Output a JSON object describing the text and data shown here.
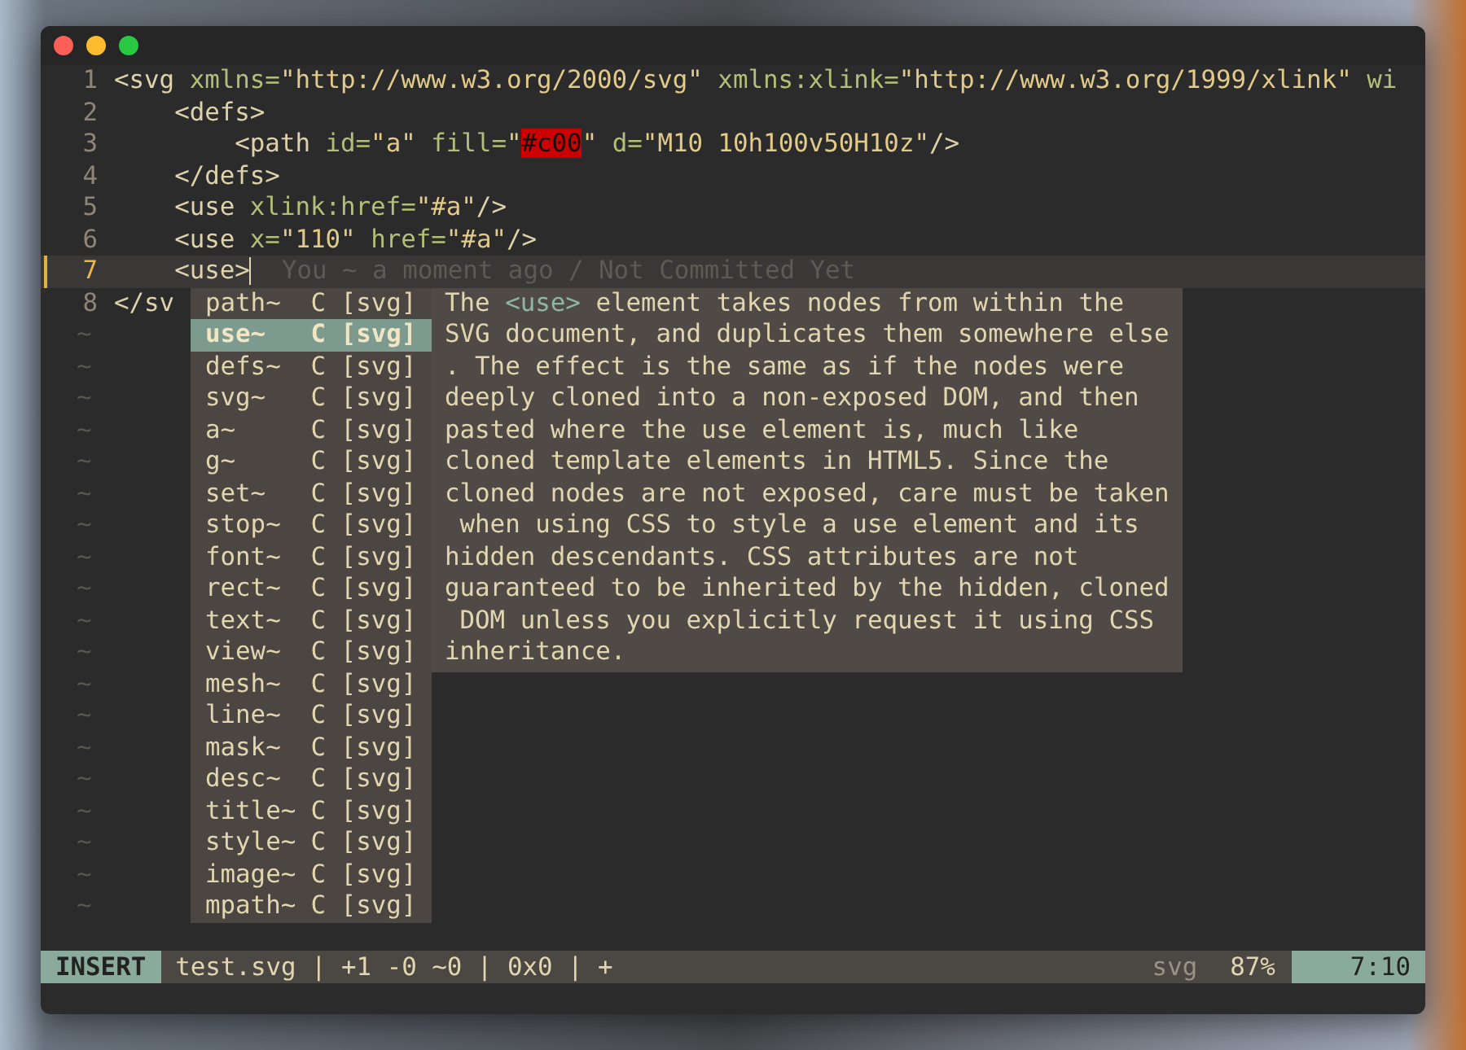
{
  "window": {
    "buttons": [
      {
        "kind": "close"
      },
      {
        "kind": "minimize"
      },
      {
        "kind": "zoom"
      }
    ]
  },
  "editor": {
    "lines": [
      {
        "number": "1",
        "current": false,
        "sign": false,
        "segments": [
          {
            "kind": "tag",
            "text": "<svg"
          },
          {
            "kind": "attr",
            "text": " xmlns="
          },
          {
            "kind": "string",
            "text": "\"http://www.w3.org/2000/svg\""
          },
          {
            "kind": "attr",
            "text": " xmlns:xlink="
          },
          {
            "kind": "string",
            "text": "\"http://www.w3.org/1999/xlink\""
          },
          {
            "kind": "attr",
            "text": " wi"
          }
        ]
      },
      {
        "number": "2",
        "current": false,
        "sign": false,
        "segments": [
          {
            "kind": "tag",
            "text": "    <defs>"
          }
        ]
      },
      {
        "number": "3",
        "current": false,
        "sign": false,
        "segments": [
          {
            "kind": "tag",
            "text": "        <path"
          },
          {
            "kind": "attr",
            "text": " id="
          },
          {
            "kind": "string",
            "text": "\"a\""
          },
          {
            "kind": "attr",
            "text": " fill="
          },
          {
            "kind": "string",
            "text": "\""
          },
          {
            "kind": "color",
            "text": "#c00"
          },
          {
            "kind": "string",
            "text": "\""
          },
          {
            "kind": "attr",
            "text": " d="
          },
          {
            "kind": "string",
            "text": "\"M10 10h100v50H10z\""
          },
          {
            "kind": "tag",
            "text": "/>"
          }
        ]
      },
      {
        "number": "4",
        "current": false,
        "sign": false,
        "segments": [
          {
            "kind": "tag",
            "text": "    </defs>"
          }
        ]
      },
      {
        "number": "5",
        "current": false,
        "sign": false,
        "segments": [
          {
            "kind": "tag",
            "text": "    <use"
          },
          {
            "kind": "attr",
            "text": " xlink:href="
          },
          {
            "kind": "string",
            "text": "\"#a\""
          },
          {
            "kind": "tag",
            "text": "/>"
          }
        ]
      },
      {
        "number": "6",
        "current": false,
        "sign": false,
        "segments": [
          {
            "kind": "tag",
            "text": "    <use"
          },
          {
            "kind": "attr",
            "text": " x="
          },
          {
            "kind": "string",
            "text": "\"110\""
          },
          {
            "kind": "attr",
            "text": " href="
          },
          {
            "kind": "string",
            "text": "\"#a\""
          },
          {
            "kind": "tag",
            "text": "/>"
          }
        ]
      },
      {
        "number": "7",
        "current": true,
        "sign": true,
        "segments": [
          {
            "kind": "tag",
            "text": "    <use>"
          },
          {
            "kind": "cursor"
          },
          {
            "kind": "blame",
            "text": "  You ~ a moment ago / Not Committed Yet"
          }
        ]
      },
      {
        "number": "8",
        "current": false,
        "sign": false,
        "segments": [
          {
            "kind": "tag",
            "text": "</sv"
          }
        ]
      }
    ],
    "empty_lines": [
      "~",
      "~",
      "~",
      "~",
      "~",
      "~",
      "~",
      "~",
      "~",
      "~",
      "~",
      "~",
      "~",
      "~",
      "~",
      "~",
      "~",
      "~",
      "~"
    ]
  },
  "completion": {
    "items": [
      {
        "word": "path~",
        "kind": "C",
        "menu": "[svg]",
        "selected": false
      },
      {
        "word": "use~",
        "kind": "C",
        "menu": "[svg]",
        "selected": true
      },
      {
        "word": "defs~",
        "kind": "C",
        "menu": "[svg]",
        "selected": false
      },
      {
        "word": "svg~",
        "kind": "C",
        "menu": "[svg]",
        "selected": false
      },
      {
        "word": "a~",
        "kind": "C",
        "menu": "[svg]",
        "selected": false
      },
      {
        "word": "g~",
        "kind": "C",
        "menu": "[svg]",
        "selected": false
      },
      {
        "word": "set~",
        "kind": "C",
        "menu": "[svg]",
        "selected": false
      },
      {
        "word": "stop~",
        "kind": "C",
        "menu": "[svg]",
        "selected": false
      },
      {
        "word": "font~",
        "kind": "C",
        "menu": "[svg]",
        "selected": false
      },
      {
        "word": "rect~",
        "kind": "C",
        "menu": "[svg]",
        "selected": false
      },
      {
        "word": "text~",
        "kind": "C",
        "menu": "[svg]",
        "selected": false
      },
      {
        "word": "view~",
        "kind": "C",
        "menu": "[svg]",
        "selected": false
      },
      {
        "word": "mesh~",
        "kind": "C",
        "menu": "[svg]",
        "selected": false
      },
      {
        "word": "line~",
        "kind": "C",
        "menu": "[svg]",
        "selected": false
      },
      {
        "word": "mask~",
        "kind": "C",
        "menu": "[svg]",
        "selected": false
      },
      {
        "word": "desc~",
        "kind": "C",
        "menu": "[svg]",
        "selected": false
      },
      {
        "word": "title~",
        "kind": "C",
        "menu": "[svg]",
        "selected": false
      },
      {
        "word": "style~",
        "kind": "C",
        "menu": "[svg]",
        "selected": false
      },
      {
        "word": "image~",
        "kind": "C",
        "menu": "[svg]",
        "selected": false
      },
      {
        "word": "mpath~",
        "kind": "C",
        "menu": "[svg]",
        "selected": false
      }
    ],
    "documentation": [
      [
        {
          "kind": "text",
          "text": "The "
        },
        {
          "kind": "code",
          "text": "<use>"
        },
        {
          "kind": "text",
          "text": " element takes nodes from within the"
        }
      ],
      [
        {
          "kind": "text",
          "text": "SVG document, and duplicates them somewhere else"
        }
      ],
      [
        {
          "kind": "text",
          "text": ". The effect is the same as if the nodes were"
        }
      ],
      [
        {
          "kind": "text",
          "text": "deeply cloned into a non-exposed DOM, and then"
        }
      ],
      [
        {
          "kind": "text",
          "text": "pasted where the use element is, much like"
        }
      ],
      [
        {
          "kind": "text",
          "text": "cloned template elements in HTML5. Since the"
        }
      ],
      [
        {
          "kind": "text",
          "text": "cloned nodes are not exposed, care must be taken"
        }
      ],
      [
        {
          "kind": "text",
          "text": " when using CSS to style a use element and its"
        }
      ],
      [
        {
          "kind": "text",
          "text": "hidden descendants. CSS attributes are not"
        }
      ],
      [
        {
          "kind": "text",
          "text": "guaranteed to be inherited by the hidden, cloned"
        }
      ],
      [
        {
          "kind": "text",
          "text": " DOM unless you explicitly request it using CSS"
        }
      ],
      [
        {
          "kind": "text",
          "text": "inheritance."
        }
      ]
    ]
  },
  "status_bar": {
    "mode": "INSERT",
    "file_info": "test.svg | +1 -0 ~0 | 0x0 | +",
    "filetype": "svg",
    "percent": "87%",
    "position": "7:10"
  }
}
